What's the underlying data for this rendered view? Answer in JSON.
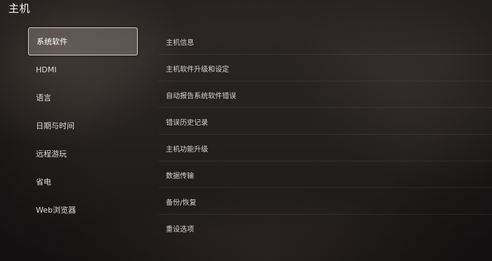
{
  "header": {
    "title": "主机"
  },
  "sidebar": {
    "items": [
      {
        "label": "系统软件",
        "selected": true
      },
      {
        "label": "HDMI",
        "selected": false
      },
      {
        "label": "语言",
        "selected": false
      },
      {
        "label": "日期与时间",
        "selected": false
      },
      {
        "label": "远程游玩",
        "selected": false
      },
      {
        "label": "省电",
        "selected": false
      },
      {
        "label": "Web浏览器",
        "selected": false
      }
    ]
  },
  "main": {
    "items": [
      {
        "label": "主机信息"
      },
      {
        "label": "主机软件升级和设定"
      },
      {
        "label": "自动报告系统软件错误"
      },
      {
        "label": "错误历史记录"
      },
      {
        "label": "主机功能升级"
      },
      {
        "label": "数据传输"
      },
      {
        "label": "备份/恢复"
      },
      {
        "label": "重设选项"
      }
    ]
  }
}
